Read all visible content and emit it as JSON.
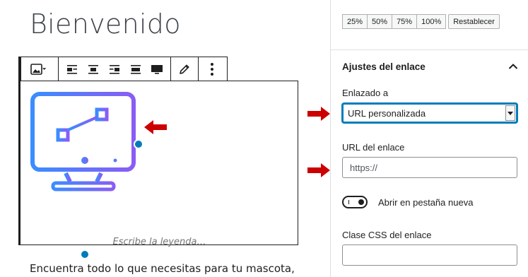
{
  "editor": {
    "title": "Bienvenido",
    "caption_placeholder": "Escribe la leyenda…",
    "paragraph": "Encuentra todo lo que necesitas para tu mascota,"
  },
  "toolbar": {
    "icons": [
      "image-icon",
      "align-left-icon",
      "align-center-icon",
      "align-right-icon",
      "wide-width-icon",
      "full-width-icon",
      "pencil-icon",
      "more-options-icon"
    ]
  },
  "image": {
    "subject": "monitor-icon"
  },
  "sidebar": {
    "sizes": [
      "25%",
      "50%",
      "75%",
      "100%"
    ],
    "reset_label": "Restablecer",
    "panel_title": "Ajustes del enlace",
    "link_to_label": "Enlazado a",
    "link_to_value": "URL personalizada",
    "link_url_label": "URL del enlace",
    "link_url_value": "https://",
    "new_tab_label": "Abrir en pestaña nueva",
    "new_tab_enabled": false,
    "css_class_label": "Clase CSS del enlace",
    "css_class_value": ""
  },
  "colors": {
    "accent": "#007cba",
    "annotation_arrow": "#cc0000",
    "gradient_start": "#3a8dff",
    "gradient_end": "#8a5cf5"
  }
}
